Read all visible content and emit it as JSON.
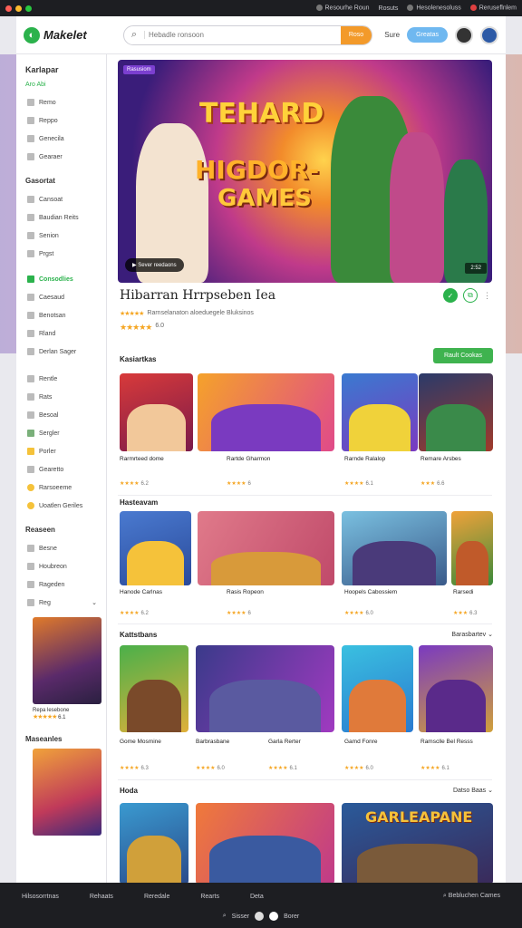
{
  "window": {
    "controls": [
      "#ff5f57",
      "#febc2e",
      "#28c840"
    ]
  },
  "topbar": {
    "links": [
      "Resourhe Roun",
      "Rosuts",
      "Hesolenesoluss",
      "Reruseflnlem"
    ]
  },
  "header": {
    "logo": "Makelet",
    "search_placeholder": "Hebadle ronsoon",
    "search_button": "Roso",
    "link": "Sure",
    "pill": "Greatas"
  },
  "sidebar": {
    "title": "Karlapar",
    "subtitle": "Aro Abi",
    "group1": [
      "Remo",
      "Reppo",
      "Genecila",
      "Gearaer"
    ],
    "section2": "Gasortat",
    "group2": [
      "Cansoat",
      "Baudian Reits",
      "Senion",
      "Prgst"
    ],
    "active": "Consodlies",
    "group3": [
      "Caesaud",
      "Benotsan",
      "Rland",
      "Derlan Sager"
    ],
    "group4": [
      "Rentle",
      "Rats",
      "Besoal",
      "Sergler",
      "Porler",
      "Gearetto",
      "Rarsoeeme",
      "Uoatlen Geriles"
    ],
    "section5": "Reaseen",
    "group5": [
      "Besne",
      "Houbreon",
      "Rageden",
      "Reg"
    ],
    "card1_label": "Repa lesebone",
    "card1_rating": "6.1",
    "section6": "Maseanles"
  },
  "hero": {
    "tag": "Rasusiom",
    "line1": "TEHARD",
    "line2": "HIGDOR-",
    "line3": "GAMES",
    "play": "Sever reedaons",
    "timer": "2:52"
  },
  "featured": {
    "title": "Hibarran Hrrpseben Iea",
    "meta1": "Rarnselanaton aloeduegele Bluksinos",
    "rating": "6.0"
  },
  "section1": {
    "title": "Kasiartkas",
    "button": "Rault Cookas",
    "cards": [
      {
        "label": "Rarmrteed dome",
        "rating": "6.2"
      },
      {
        "label": "Rartde Gharmon",
        "rating": "6"
      },
      {
        "label": "Rarnde Ralalop",
        "rating": "6.1"
      },
      {
        "label": "Remare Arsbes",
        "rating": "6.6"
      }
    ]
  },
  "section2": {
    "title": "Hasteavam",
    "cards": [
      {
        "label": "Hanode Carlnas",
        "rating": "6.2"
      },
      {
        "label": "Rasis Ropeon",
        "rating": "6"
      },
      {
        "label": "Hoopels Cabossiem",
        "rating": "6.0"
      },
      {
        "label": "Rarsedi",
        "rating": "6.3"
      }
    ]
  },
  "section3": {
    "title": "Kattstbans",
    "right": "Barasbartev",
    "cards": [
      {
        "label": "Gome Mosmine",
        "rating": "6.3"
      },
      {
        "label": "Barbrasbane",
        "rating": "6.0"
      },
      {
        "label": "Garla Rerter",
        "rating": "6.1"
      },
      {
        "label": "Gamd Fonre",
        "rating": "6.0"
      },
      {
        "label": "Ramsclle Bel Resss",
        "rating": "6.1"
      }
    ]
  },
  "section4": {
    "title": "Hoda",
    "right": "Datso Baas"
  },
  "hero_text": "GARLEAPANE",
  "footer": {
    "left": "Hilsosorrtnas",
    "links": [
      "Rehaats",
      "Reredale",
      "Rearts",
      "Deta"
    ],
    "right": "Bebluchen Cames",
    "bottom": [
      "Sisser",
      "Borer"
    ]
  }
}
